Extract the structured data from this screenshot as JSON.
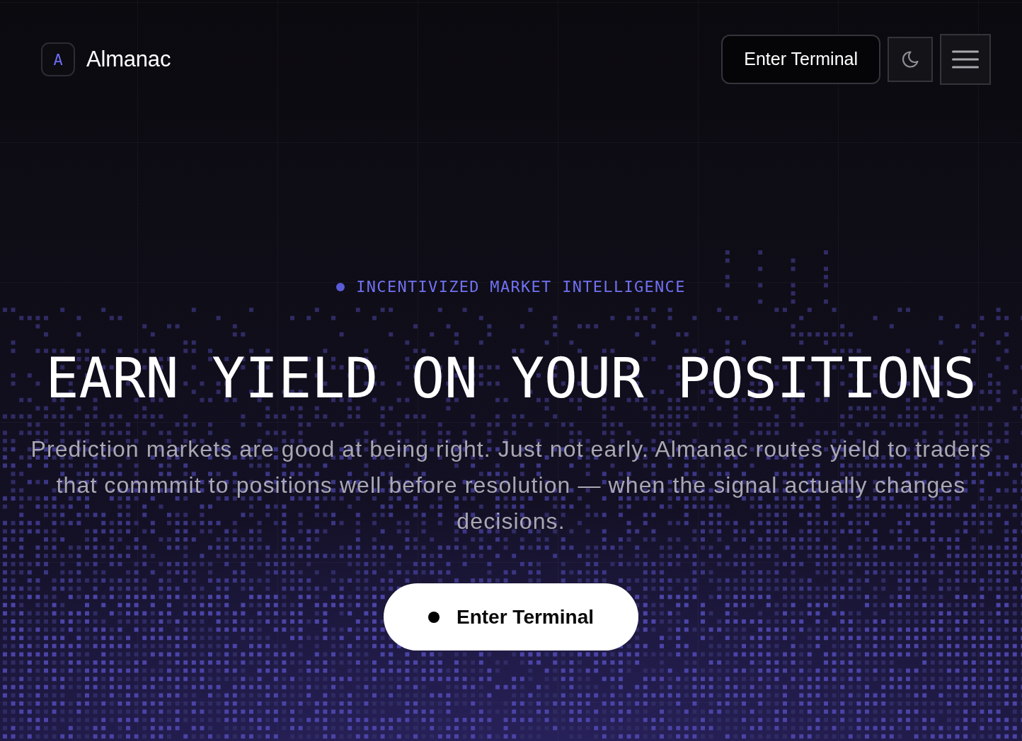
{
  "brand": {
    "logo_letter": "A",
    "name": "Almanac"
  },
  "nav": {
    "terminal_button": "Enter Terminal"
  },
  "hero": {
    "eyebrow": "INCENTIVIZED MARKET INTELLIGENCE",
    "title": "EARN YIELD ON YOUR POSITIONS",
    "description": "Prediction markets are good at being right. Just not early. Almanac routes yield to traders that commmit to positions well before resolution — when the signal actually changes decisions.",
    "cta": "Enter Terminal"
  }
}
